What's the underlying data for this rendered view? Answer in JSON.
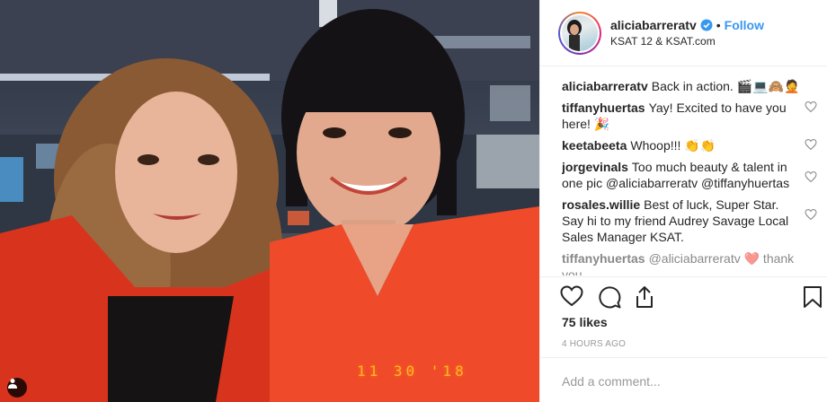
{
  "post": {
    "photo": {
      "timestamp": "11 30 '18",
      "user_tag_icon": "person-icon"
    }
  },
  "header": {
    "username": "aliciabarreratv",
    "separator": "•",
    "follow_label": "Follow",
    "location": "KSAT 12 & KSAT.com",
    "verified_icon": "verified-badge-icon"
  },
  "comments": [
    {
      "author": "aliciabarreratv",
      "text": "Back in action. 🎬💻🙈🤦",
      "likeable": false
    },
    {
      "author": "tiffanyhuertas",
      "text": "Yay! Excited to have you here! 🎉",
      "likeable": true
    },
    {
      "author": "keetabeeta",
      "text": "Whoop!!! 👏👏",
      "likeable": true
    },
    {
      "author": "jorgevinals",
      "text": "Too much beauty & talent in one pic @aliciabarreratv @tiffanyhuertas",
      "likeable": true
    },
    {
      "author": "rosales.willie",
      "text": "Best of luck, Super Star. Say hi to my friend Audrey Savage Local Sales Manager KSAT.",
      "likeable": true
    },
    {
      "author": "tiffanyhuertas",
      "text": "@aliciabarreratv ❤️ thank you",
      "likeable": true
    }
  ],
  "actions": {
    "like_icon": "heart-icon",
    "comment_icon": "comment-icon",
    "share_icon": "share-icon",
    "save_icon": "bookmark-icon"
  },
  "likes": "75 likes",
  "posted_time": "4 HOURS AGO",
  "add_comment_placeholder": "Add a comment...",
  "colors": {
    "link": "#3897f0",
    "text": "#262626",
    "muted": "#999999",
    "border": "#efefef",
    "timestamp": "#ffb22e"
  }
}
